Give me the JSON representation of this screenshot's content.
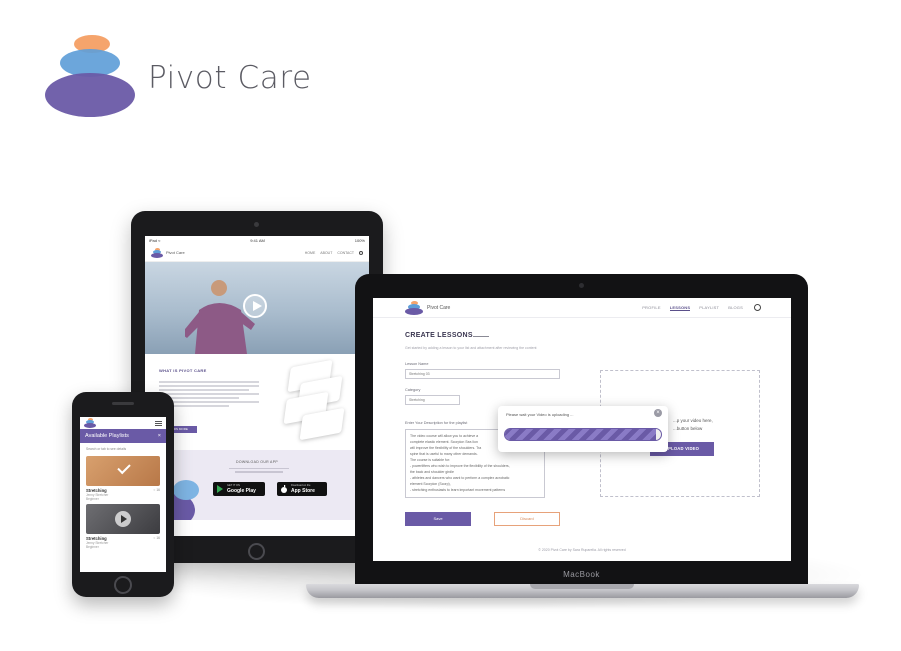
{
  "brand": {
    "name": "Pivot Care",
    "colors": {
      "peach": "#f5a46c",
      "blue": "#5f9ed8",
      "purple": "#6a5aa6"
    }
  },
  "tablet": {
    "status_left": "iPad ≈",
    "status_time": "9:41 AM",
    "status_right": "100%",
    "logo_text": "Pivot Care",
    "nav_links": [
      "HOME",
      "ABOUT",
      "CONTACT"
    ],
    "section_title": "WHAT IS PIVOT CARE",
    "cta_label": "LEARN MORE",
    "download_title": "DOWNLOAD OUR APP",
    "google_play": {
      "small": "GET IT ON",
      "big": "Google Play"
    },
    "app_store": {
      "small": "Download on the",
      "big": "App Store"
    }
  },
  "laptop": {
    "label": "MacBook",
    "logo_text": "Pivot Care",
    "nav_links": [
      {
        "label": "PROFILE",
        "active": false
      },
      {
        "label": "LESSONS",
        "active": true
      },
      {
        "label": "PLAYLIST",
        "active": false
      },
      {
        "label": "BLOGS",
        "active": false
      }
    ],
    "page_title": "CREATE LESSONS",
    "subtitle": "Get started by adding a lesson to your list and attachment after reviewing the content",
    "lesson_name_label": "Lesson Name",
    "lesson_name_value": "Stretching 03",
    "category_label": "Category",
    "category_value": "Stretching",
    "description_label": "Enter Your Description for the playlist",
    "description_lines": [
      "The video course will allow you to achieve a",
      "complete elastic element. Scorpion Sea lion",
      "will improve the flexibility of the shoulders. Tra",
      "spine that is useful to many other demands.",
      "The course is suitable for:",
      "- powerlifters who wish to improve the flexibility of the shoulders,",
      "the back and shoulder girdle",
      "- athletes and dancers who want to perform a complex acrobatic",
      "element Scorpion (Scorp),",
      "- stretching enthusiasts to learn important movement patterns"
    ],
    "upload_hint_1": "...p your video here,",
    "upload_hint_2": "...button below",
    "upload_button": "UPLOAD VIDEO",
    "save_button": "Save",
    "discard_button": "Discard",
    "footer": "© 2020 Pivot Care by Sara Ruparelia. All rights reserved",
    "modal": {
      "text": "Please wait your Video is uploading ...",
      "close": "×",
      "progress": 0.97
    }
  },
  "phone": {
    "header_title": "Available Playlists",
    "header_close": "×",
    "search_hint": "Search or tab to see details",
    "cards": [
      {
        "title": "Stretching",
        "views": "○ 16",
        "sub1": "Jenny Stretcher",
        "sub2": "Beginner"
      },
      {
        "title": "Stretching",
        "views": "○ 16",
        "sub1": "Jenny Stretcher",
        "sub2": "Beginner"
      }
    ]
  }
}
